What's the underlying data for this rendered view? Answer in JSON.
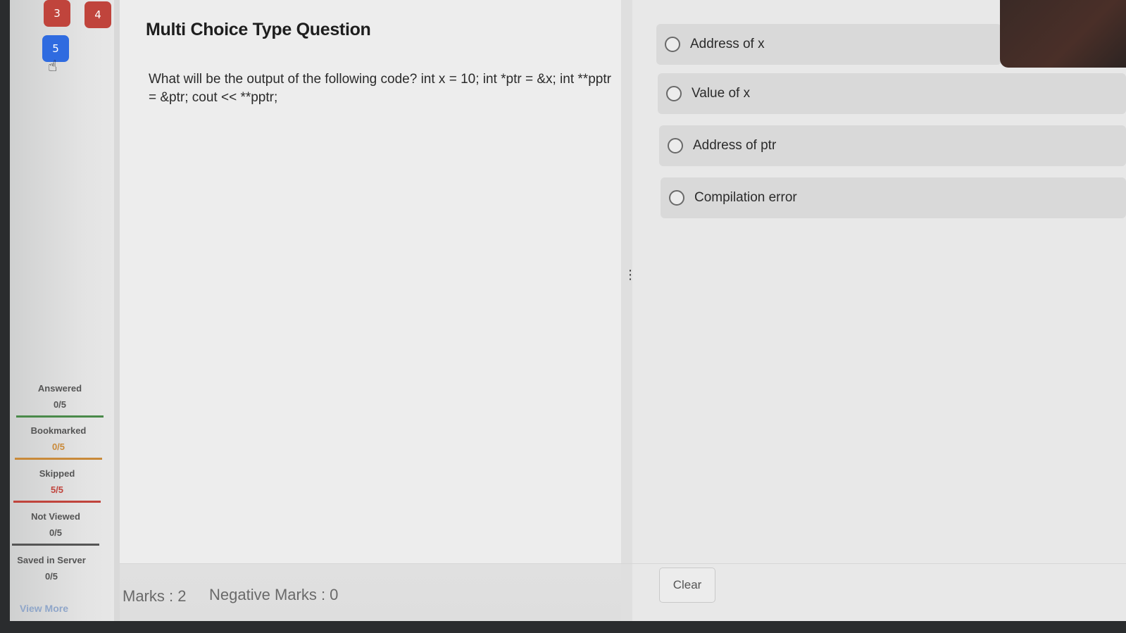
{
  "sidebar": {
    "question_buttons": [
      {
        "label": "3",
        "color": "#c0443c"
      },
      {
        "label": "4",
        "color": "#c0443c"
      },
      {
        "label": "5",
        "color": "#2f6be0"
      }
    ],
    "stats": [
      {
        "label": "Answered",
        "value": "0/5",
        "color": "#4a8a4a"
      },
      {
        "label": "Bookmarked",
        "value": "0/5",
        "color": "#c98a3a"
      },
      {
        "label": "Skipped",
        "value": "5/5",
        "color": "#c0443c"
      },
      {
        "label": "Not Viewed",
        "value": "0/5",
        "color": "#555555"
      },
      {
        "label": "Saved in Server",
        "value": "0/5",
        "color": "#555555"
      }
    ],
    "view_more": "View More"
  },
  "question": {
    "title": "Multi Choice Type Question",
    "text": "What will be the output of the following code? int x = 10; int *ptr = &x; int **pptr = &ptr; cout << **pptr;"
  },
  "options": [
    {
      "label": "Address of x",
      "selected": false
    },
    {
      "label": "Value of x",
      "selected": false
    },
    {
      "label": "Address of ptr",
      "selected": false
    },
    {
      "label": "Compilation error",
      "selected": false
    }
  ],
  "footer": {
    "marks": "Marks : 2",
    "negative_marks": "Negative Marks : 0",
    "clear_label": "Clear"
  },
  "icons": {
    "drag_handle": "drag-handle-icon",
    "cursor": "hand-cursor-icon"
  }
}
